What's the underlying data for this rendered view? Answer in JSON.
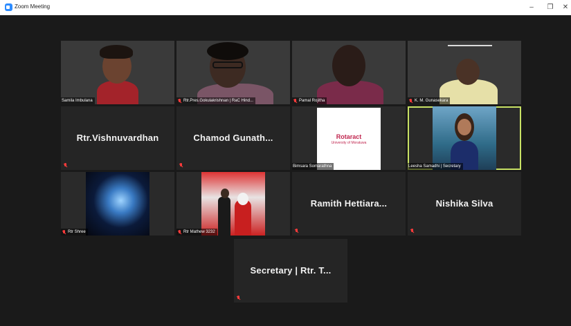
{
  "window": {
    "title": "Zoom Meeting",
    "controls": {
      "minimize": "–",
      "maximize": "❐",
      "close": "✕"
    }
  },
  "tiles": [
    {
      "type": "video",
      "name": "Samila Imbulana"
    },
    {
      "type": "video",
      "name": "Rtr.Pres.Gokulakrishnan | RaC Hind..."
    },
    {
      "type": "video",
      "name": "Pamal Rojitha"
    },
    {
      "type": "video",
      "name": "K. M. Gunasekara"
    },
    {
      "type": "name",
      "display": "Rtr.Vishnuvardhan"
    },
    {
      "type": "name",
      "display": "Chamod  Gunath..."
    },
    {
      "type": "logo",
      "name": "Bimsara Somarathna",
      "logo_title": "Rotaract",
      "logo_subtitle": "University of Moratuwa"
    },
    {
      "type": "photo",
      "name": "Leesha Samadhi | Secretary",
      "active": true
    },
    {
      "type": "photo",
      "name": "Rtr Shree"
    },
    {
      "type": "photo",
      "name": "Rtr Mathew 3232"
    },
    {
      "type": "name",
      "display": "Ramith  Hettiara..."
    },
    {
      "type": "name",
      "display": "Nishika Silva"
    },
    {
      "type": "name",
      "display": "Secretary | Rtr. T..."
    }
  ],
  "colors": {
    "active_speaker": "#c9e265",
    "muted_mic": "#ff3b3b",
    "zoom_blue": "#2d8cff"
  },
  "icons": {
    "muted": "muted-mic-icon",
    "app": "zoom-app-icon"
  }
}
